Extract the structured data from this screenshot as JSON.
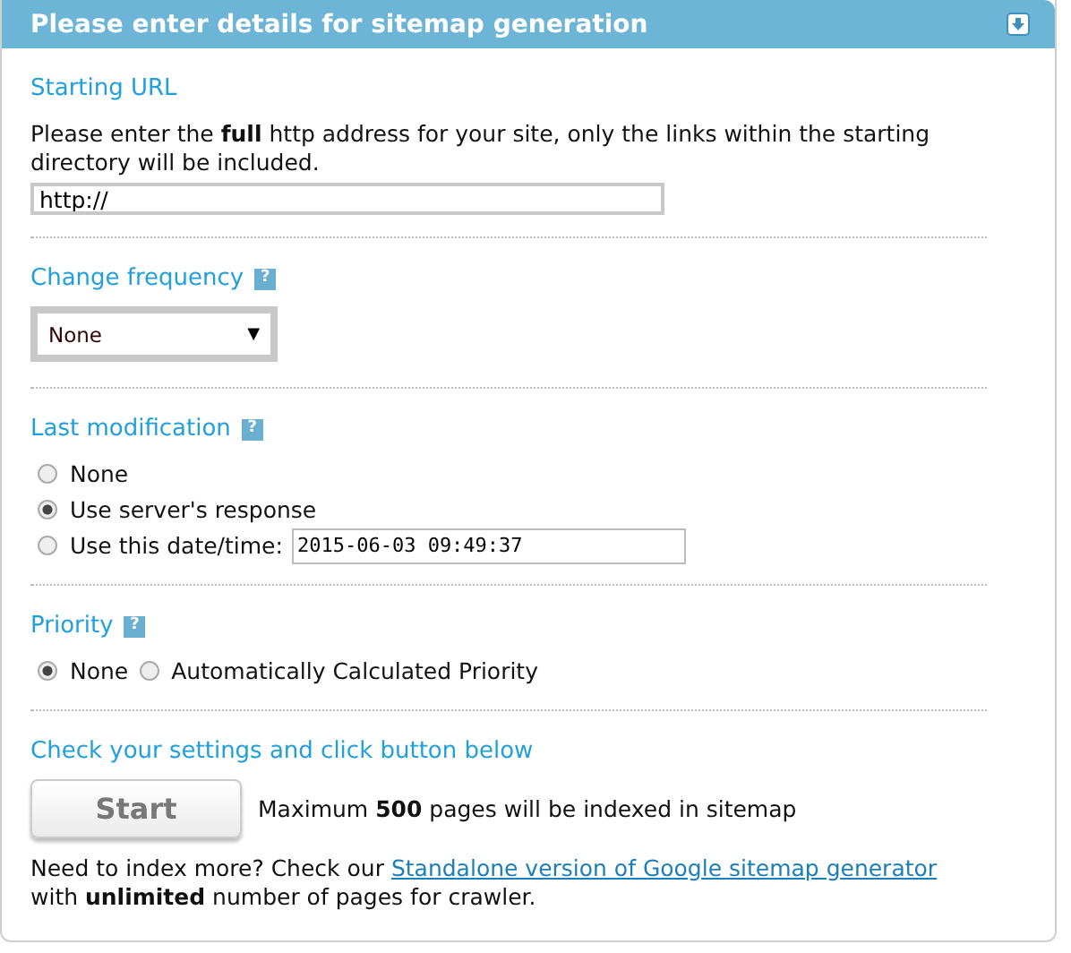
{
  "panel": {
    "title": "Please enter details for sitemap generation"
  },
  "starting_url": {
    "heading": "Starting URL",
    "description": "Please enter the **full** http address for your site, only the links within the starting directory will be included.",
    "value": "http://"
  },
  "change_frequency": {
    "heading": "Change frequency",
    "help": "?",
    "value": "None",
    "caret": "▼"
  },
  "last_modification": {
    "heading": "Last modification",
    "help": "?",
    "options": [
      {
        "label": "None",
        "selected": false
      },
      {
        "label": "Use server's response",
        "selected": true
      },
      {
        "label": "Use this date/time:",
        "selected": false,
        "value": "2015-06-03 09:49:37"
      }
    ]
  },
  "priority": {
    "heading": "Priority",
    "help": "?",
    "kind": "inline",
    "options": [
      {
        "label": "None",
        "selected": true
      },
      {
        "label": "Automatically Calculated Priority",
        "selected": false
      }
    ]
  },
  "submit": {
    "heading": "Check your settings and click button below",
    "button": "Start",
    "note": "Maximum **500** pages will be indexed in sitemap"
  },
  "footer": {
    "before": "Need to index more? Check our",
    "link": "Standalone version of Google sitemap generator",
    "after": "with **unlimited** number of pages for crawler."
  }
}
